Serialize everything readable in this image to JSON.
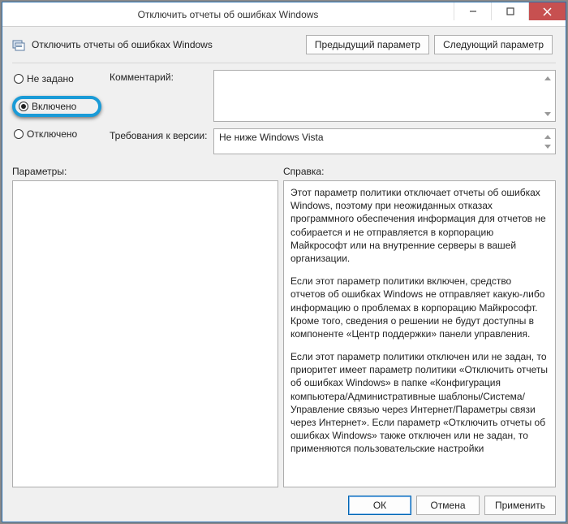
{
  "window": {
    "title": "Отключить отчеты об ошибках Windows"
  },
  "header": {
    "policy_title": "Отключить отчеты об ошибках Windows",
    "prev_button": "Предыдущий параметр",
    "next_button": "Следующий параметр"
  },
  "radios": {
    "not_configured": "Не задано",
    "enabled": "Включено",
    "disabled": "Отключено",
    "selected": "enabled"
  },
  "fields": {
    "comment_label": "Комментарий:",
    "comment_value": "",
    "requirements_label": "Требования к версии:",
    "requirements_value": "Не ниже Windows Vista"
  },
  "section_labels": {
    "parameters": "Параметры:",
    "help": "Справка:"
  },
  "help": {
    "p1": "Этот параметр политики отключает отчеты об ошибках Windows, поэтому при неожиданных отказах программного обеспечения информация для отчетов не собирается и не отправляется в корпорацию Майкрософт или на внутренние серверы в вашей организации.",
    "p2": "Если этот параметр политики включен, средство отчетов об ошибках Windows не отправляет какую-либо информацию о проблемах в корпорацию Майкрософт. Кроме того, сведения о решении не будут доступны в компоненте «Центр поддержки» панели управления.",
    "p3": "Если этот параметр политики отключен или не задан, то приоритет имеет параметр политики «Отключить отчеты об ошибках Windows» в папке «Конфигурация компьютера/Административные шаблоны/Система/Управление связью через Интернет/Параметры связи через Интернет». Если параметр «Отключить отчеты об ошибках Windows» также отключен или не задан, то применяются пользовательские настройки"
  },
  "footer": {
    "ok": "ОК",
    "cancel": "Отмена",
    "apply": "Применить"
  }
}
